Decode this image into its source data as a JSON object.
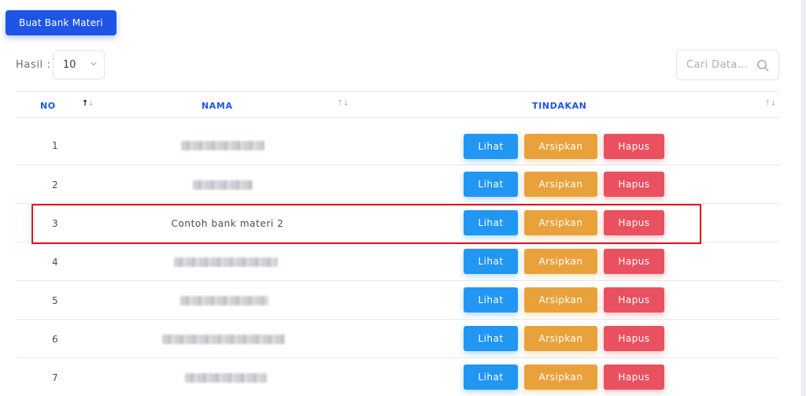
{
  "toolbar": {
    "create_label": "Buat Bank Materi"
  },
  "page_size": {
    "label": "Hasil :",
    "selected": "10"
  },
  "search": {
    "placeholder": "Cari Data..."
  },
  "table": {
    "headers": {
      "no": "NO",
      "nama": "NAMA",
      "tindakan": "TINDAKAN"
    },
    "sort_glyph": "↑↓",
    "rows": [
      {
        "no": "1",
        "nama": ""
      },
      {
        "no": "2",
        "nama": ""
      },
      {
        "no": "3",
        "nama": "Contoh bank materi 2"
      },
      {
        "no": "4",
        "nama": ""
      },
      {
        "no": "5",
        "nama": ""
      },
      {
        "no": "6",
        "nama": ""
      },
      {
        "no": "7",
        "nama": ""
      }
    ],
    "actions": {
      "view": "Lihat",
      "archive": "Arsipkan",
      "delete": "Hapus"
    }
  },
  "colors": {
    "primary": "#1f55e6",
    "view": "#2196f3",
    "archive": "#e9a23b",
    "delete": "#ea5160",
    "highlight": "#e0161c"
  }
}
